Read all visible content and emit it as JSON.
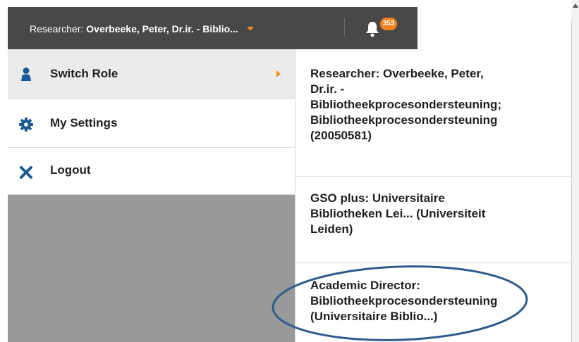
{
  "header": {
    "role_prefix": "Researcher:",
    "role_name": "Overbeeke, Peter, Dr.ir. - Biblio...",
    "notification_count": "353"
  },
  "menu": {
    "items": [
      {
        "label": "Switch Role",
        "icon": "user-icon"
      },
      {
        "label": "My Settings",
        "icon": "gear-icon"
      },
      {
        "label": "Logout",
        "icon": "close-icon"
      }
    ]
  },
  "submenu": {
    "roles": [
      {
        "lines": [
          "Researcher: Overbeeke, Peter,",
          "Dr.ir. -",
          "Bibliotheekprocesondersteuning;",
          "Bibliotheekprocesondersteuning",
          "(20050581)"
        ]
      },
      {
        "lines": [
          "GSO plus: Universitaire",
          "Bibliotheken Lei... (Universiteit",
          "Leiden)"
        ]
      },
      {
        "lines": [
          "Academic Director:",
          "Bibliotheekprocesondersteuning",
          "(Universitaire Biblio...)"
        ]
      }
    ]
  },
  "colors": {
    "header_bg": "#484848",
    "accent_orange": "#ef8c23",
    "badge_orange": "#f58220",
    "icon_blue": "#1a5a93",
    "highlight_stroke": "#2e5b8c"
  }
}
